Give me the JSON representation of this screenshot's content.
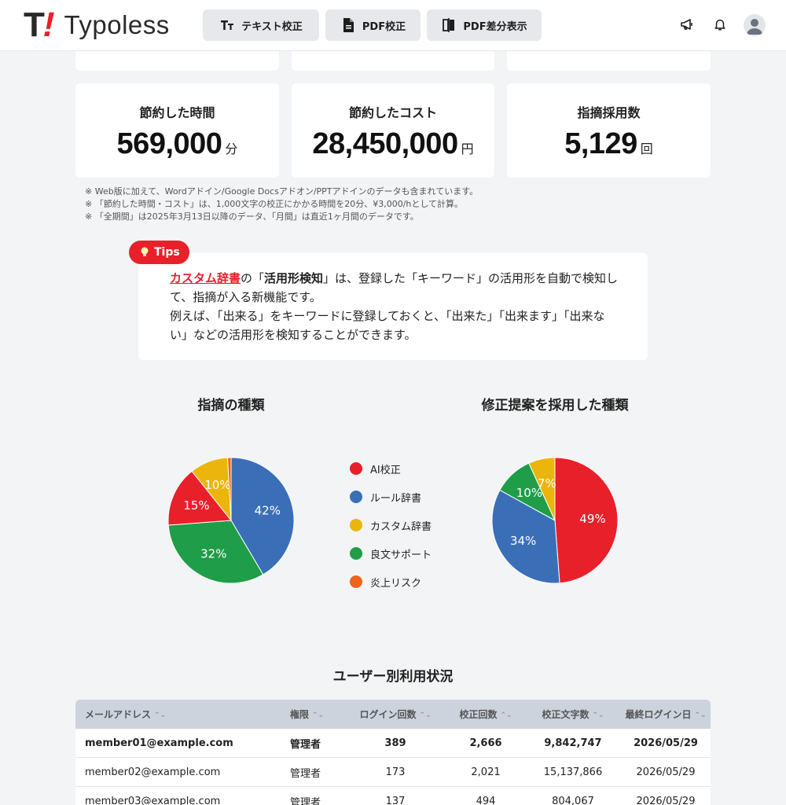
{
  "header": {
    "logo_t": "T",
    "logo_excl": "!",
    "logo_word_a": "Typo",
    "logo_word_b": "less",
    "nav": [
      {
        "label": "テキスト校正",
        "icon": "text-size-icon"
      },
      {
        "label": "PDF校正",
        "icon": "document-icon"
      },
      {
        "label": "PDF差分表示",
        "icon": "diff-icon"
      }
    ],
    "icons": [
      "megaphone-icon",
      "bell-icon",
      "user-avatar-icon"
    ]
  },
  "stats": [
    {
      "title": "節約した時間",
      "value": "569,000",
      "unit": "分"
    },
    {
      "title": "節約したコスト",
      "value": "28,450,000",
      "unit": "円"
    },
    {
      "title": "指摘採用数",
      "value": "5,129",
      "unit": "回"
    }
  ],
  "notes": [
    "※ Web版に加えて、Wordアドイン/Google Docsアドオン/PPTアドインのデータも含まれています。",
    "※ 「節約した時間・コスト」は、1,000文字の校正にかかる時間を20分、¥3,000/hとして計算。",
    "※ 「全期間」は2025年3月13日以降のデータ、「月間」は直近1ヶ月間のデータです。"
  ],
  "tips": {
    "badge": "Tips",
    "link_text": "カスタム辞書",
    "text_a": "の「",
    "bold_text": "活用形検知",
    "text_b": "」は、登録した「キーワード」の活用形を自動で検知して、指摘が入る新機能です。",
    "text_c": "例えば、「出来る」をキーワードに登録しておくと、「出来た」「出来ます」「出来ない」などの活用形を検知することができます。"
  },
  "colors": {
    "ai": "#e8202a",
    "rule": "#3a6fb8",
    "custom": "#ecb50c",
    "style": "#1f9d48",
    "risk": "#ee6419"
  },
  "chart_data": [
    {
      "type": "pie",
      "title": "指摘の種類",
      "categories": [
        "AI校正",
        "ルール辞書",
        "カスタム辞書",
        "良文サポート",
        "炎上リスク"
      ],
      "values": [
        15.5,
        41.5,
        9.8,
        32.3,
        0.9
      ],
      "labels": [
        "15%",
        "42%",
        "10%",
        "32%",
        ""
      ]
    },
    {
      "type": "pie",
      "title": "修正提案を採用した種類",
      "categories": [
        "AI校正",
        "ルール辞書",
        "カスタム辞書",
        "良文サポート",
        "炎上リスク"
      ],
      "values": [
        48.8,
        34.2,
        6.8,
        10.2,
        0
      ],
      "labels": [
        "49%",
        "34%",
        "7%",
        "10%",
        ""
      ]
    }
  ],
  "legend": [
    "AI校正",
    "ルール辞書",
    "カスタム辞書",
    "良文サポート",
    "炎上リスク"
  ],
  "table": {
    "title": "ユーザー別利用状況",
    "headers": [
      "メールアドレス",
      "権限",
      "ログイン回数",
      "校正回数",
      "校正文字数",
      "最終ログイン日"
    ],
    "rows": [
      [
        "member01@example.com",
        "管理者",
        "389",
        "2,666",
        "9,842,747",
        "2026/05/29"
      ],
      [
        "member02@example.com",
        "管理者",
        "173",
        "2,021",
        "15,137,866",
        "2026/05/29"
      ],
      [
        "member03@example.com",
        "管理者",
        "137",
        "494",
        "804,067",
        "2026/05/29"
      ]
    ]
  }
}
